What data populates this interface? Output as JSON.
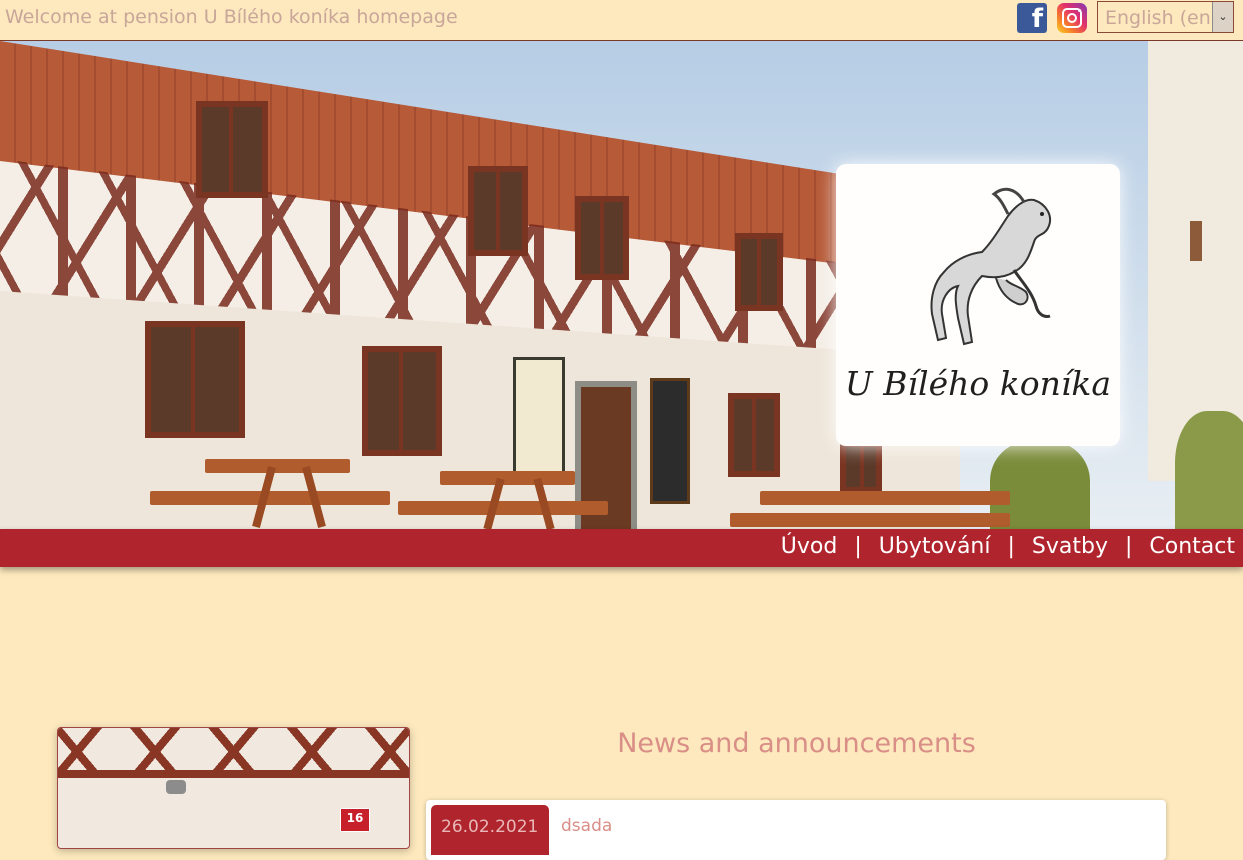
{
  "header": {
    "welcome": "Welcome at pension U Bílého koníka homepage",
    "facebook_icon": "facebook-icon",
    "instagram_icon": "instagram-icon",
    "language_selected": "English (en)"
  },
  "hero": {
    "logo_text": "U Bílého koníka",
    "house_number": "16"
  },
  "nav": {
    "items": [
      {
        "label": "Úvod"
      },
      {
        "label": "Ubytování"
      },
      {
        "label": "Svatby"
      },
      {
        "label": "Contact"
      }
    ],
    "separator": "|"
  },
  "news": {
    "title": "News and announcements",
    "items": [
      {
        "date": "26.02.2021",
        "text": "dsada"
      }
    ]
  },
  "colors": {
    "background": "#fde9bd",
    "nav": "#b0242d",
    "accent_text": "#d98e87"
  }
}
